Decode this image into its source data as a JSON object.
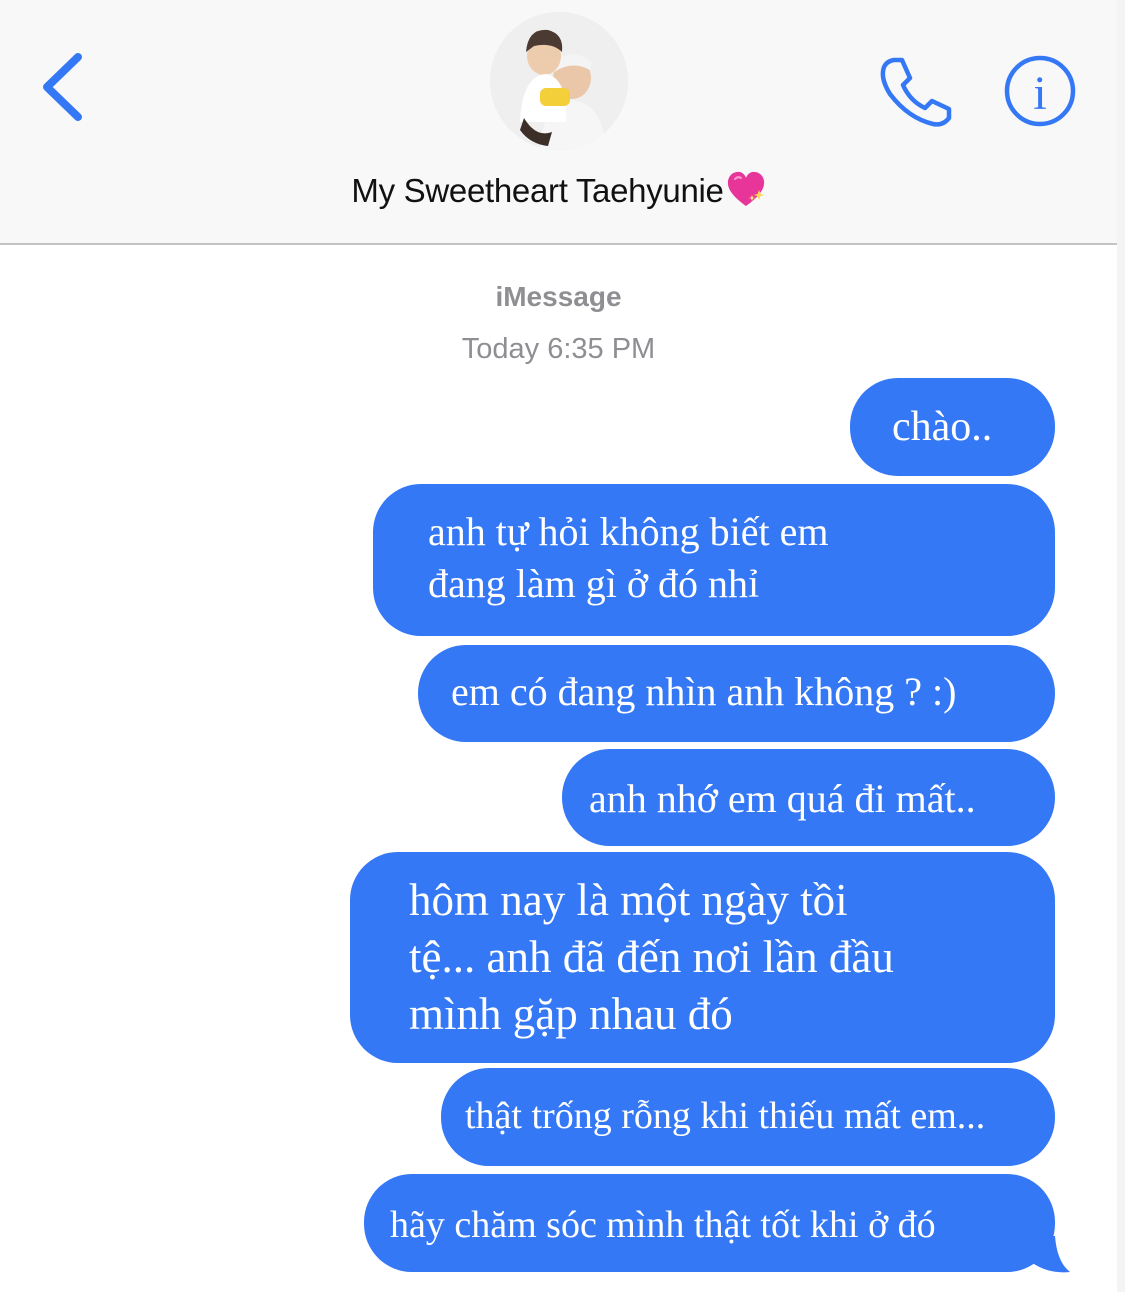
{
  "header": {
    "contact_name": "My Sweetheart Taehyunie",
    "contact_emoji": "💖",
    "accent_color": "#3478f6",
    "icons": [
      "chevron-left-icon",
      "phone-icon",
      "info-icon"
    ]
  },
  "thread": {
    "service_label": "iMessage",
    "timestamp": "Today 6:35 PM"
  },
  "messages": [
    {
      "direction": "outgoing",
      "text": "chào.."
    },
    {
      "direction": "outgoing",
      "text": "anh tự hỏi không biết em\nđang làm gì ở đó nhỉ"
    },
    {
      "direction": "outgoing",
      "text": "em có đang nhìn anh không ? :)"
    },
    {
      "direction": "outgoing",
      "text": "anh nhớ em quá đi mất.."
    },
    {
      "direction": "outgoing",
      "text": "hôm nay là một ngày tồi\ntệ... anh đã đến nơi lần đầu\nmình gặp nhau đó"
    },
    {
      "direction": "outgoing",
      "text": "thật trống rỗng khi thiếu mất em..."
    },
    {
      "direction": "outgoing",
      "text": "hãy chăm sóc mình thật tốt khi ở đó"
    }
  ]
}
